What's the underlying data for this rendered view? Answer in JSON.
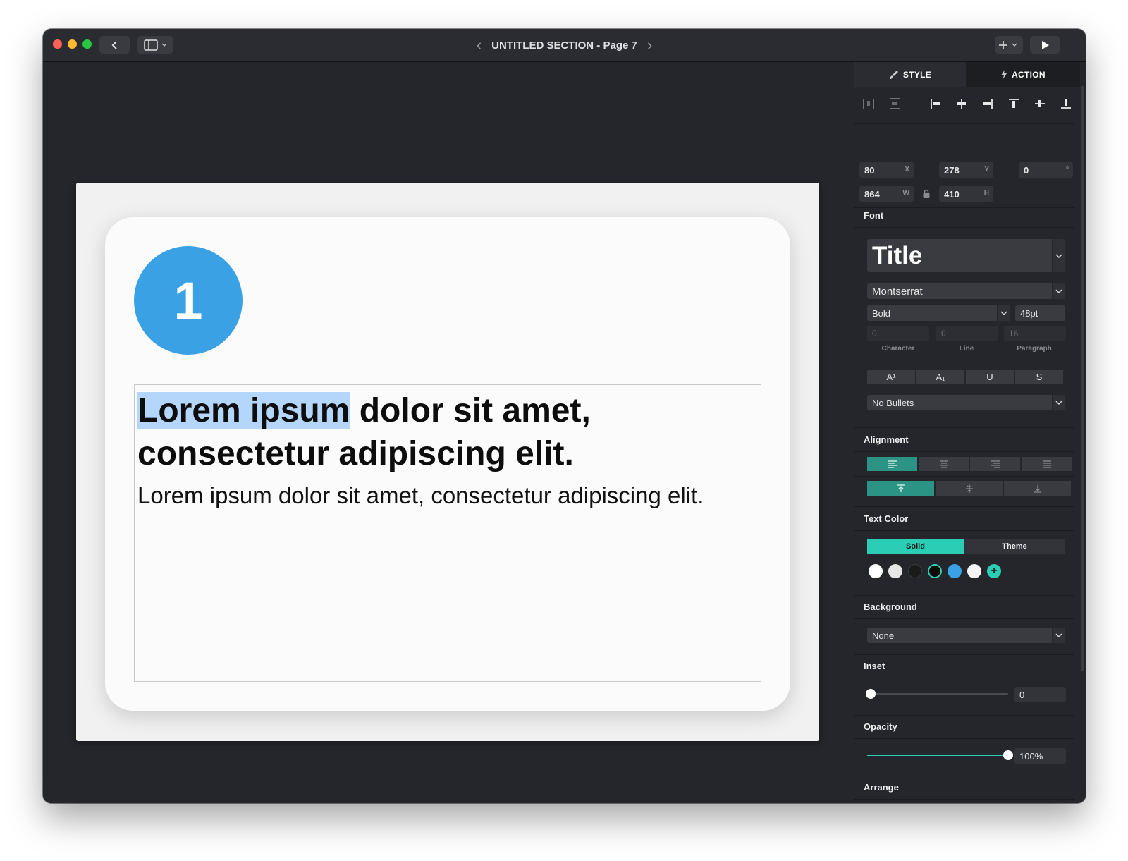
{
  "window": {
    "title": "UNTITLED SECTION - Page 7",
    "prev_icon": "chevron-left-icon",
    "next_icon": "chevron-right-icon"
  },
  "toolbar": {
    "back_icon": "chevron-left-icon",
    "sidebar_icon": "sidebar-icon",
    "add_icon": "plus-icon",
    "play_icon": "play-icon"
  },
  "slide": {
    "badge_number": "1",
    "headline_highlight": "Lorem ipsum",
    "headline_rest": " dolor sit amet, consectetur adipiscing elit.",
    "body": "Lorem ipsum dolor sit amet, consectetur adipiscing elit."
  },
  "panel": {
    "tabs": {
      "style": "STYLE",
      "action": "ACTION"
    },
    "geometry": {
      "x": "80",
      "x_label": "X",
      "y": "278",
      "y_label": "Y",
      "rotation": "0",
      "rotation_label": "°",
      "w": "864",
      "w_label": "W",
      "h": "410",
      "h_label": "H"
    },
    "font": {
      "label": "Font",
      "style_preset": "Title",
      "family": "Montserrat",
      "weight": "Bold",
      "size": "48pt",
      "character": "0",
      "line": "0",
      "paragraph": "16",
      "character_label": "Character",
      "line_label": "Line",
      "paragraph_label": "Paragraph",
      "superscript": "A¹",
      "subscript": "A₁",
      "underline": "U",
      "strikethrough": "S",
      "bullets": "No Bullets"
    },
    "alignment": {
      "label": "Alignment"
    },
    "text_color": {
      "label": "Text Color",
      "solid": "Solid",
      "theme": "Theme",
      "swatches": [
        "#ffffff",
        "#e6e6e6",
        "#1a1a1a",
        "#0a0a0a",
        "#3aa2e4",
        "#f4f4f4"
      ],
      "selected_swatch": "#0a0a0a",
      "add_icon": "plus-icon"
    },
    "background": {
      "label": "Background",
      "value": "None"
    },
    "inset": {
      "label": "Inset",
      "value": "0",
      "level": 0
    },
    "opacity": {
      "label": "Opacity",
      "value": "100%",
      "level": 1.0
    },
    "arrange": {
      "label": "Arrange"
    }
  },
  "colors": {
    "accent_teal": "#2bcdb5",
    "active_segment": "#2b9485",
    "badge_blue": "#3aa2e4",
    "highlight": "#b4d6fb"
  }
}
